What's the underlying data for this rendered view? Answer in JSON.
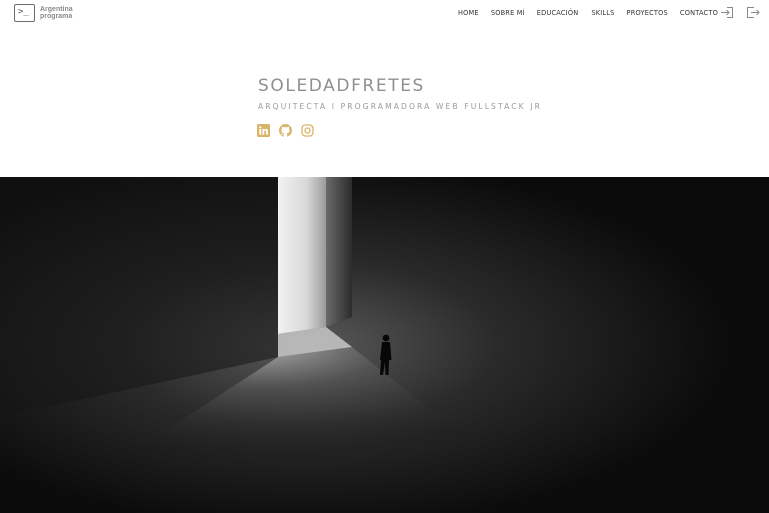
{
  "brand": {
    "logo_line1": "Argentina",
    "logo_line2": "programa",
    "logo_prompt": ">_"
  },
  "nav": {
    "items": [
      {
        "label": "HOME"
      },
      {
        "label": "SOBRE MÍ"
      },
      {
        "label": "EDUCACIÓN"
      },
      {
        "label": "SKILLS"
      },
      {
        "label": "PROYECTOS"
      },
      {
        "label": "CONTACTO"
      }
    ],
    "login_icon": "login-icon",
    "logout_icon": "logout-icon"
  },
  "hero": {
    "name": "SOLEDADFRETES",
    "subtitle": "ARQUITECTA I PROGRAMADORA WEB FULLSTACK JR",
    "socials": [
      {
        "icon": "linkedin-icon"
      },
      {
        "icon": "github-icon"
      },
      {
        "icon": "instagram-icon"
      }
    ]
  },
  "colors": {
    "accent": "#d9b46a",
    "text_muted": "#8f8f8f"
  }
}
